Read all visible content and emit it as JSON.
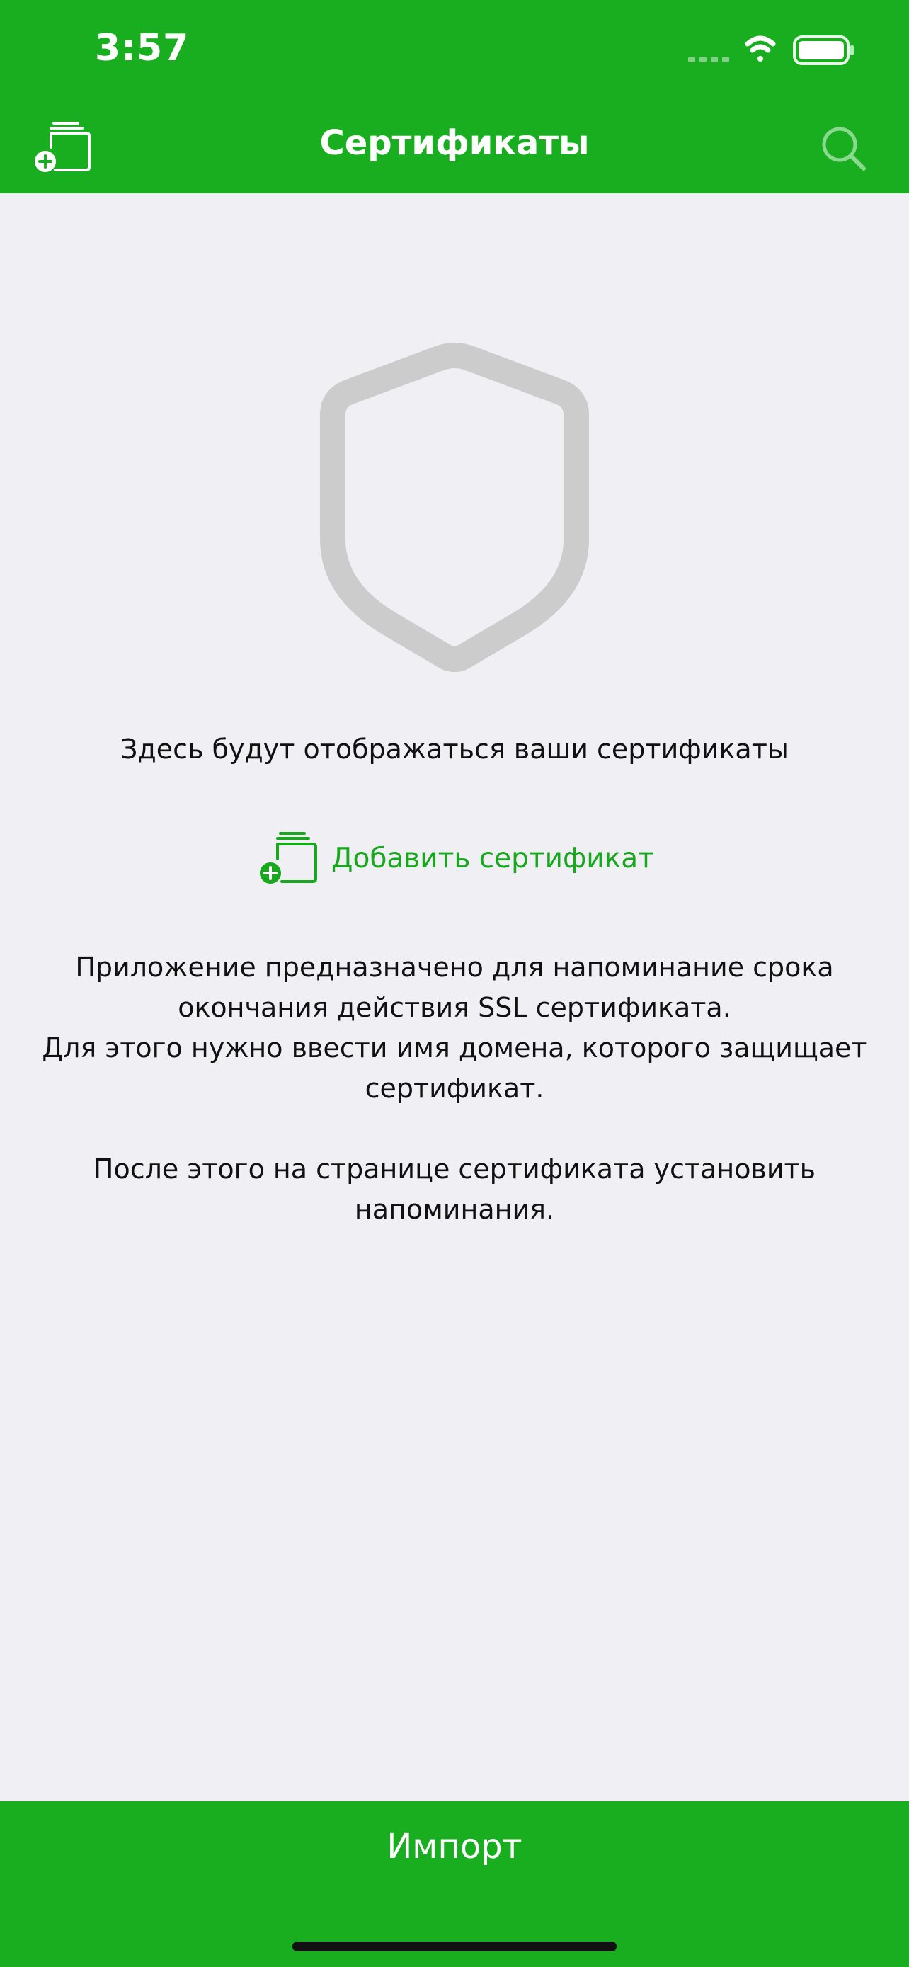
{
  "status_bar": {
    "time": "3:57",
    "icons": [
      "signal-icon",
      "wifi-icon",
      "battery-icon"
    ]
  },
  "nav": {
    "title": "Сертификаты",
    "left_icon": "add-certificate-icon",
    "right_icon": "search-icon"
  },
  "empty_state": {
    "icon": "shield-icon",
    "message": "Здесь будут отображаться ваши сертификаты",
    "add_button_label": "Добавить сертификат"
  },
  "description": {
    "paragraph1": "Приложение предназначено для напоминание срока окончания действия SSL сертификата.",
    "paragraph2": "Для этого нужно ввести имя домена, которого защищает сертификат.",
    "paragraph3": "После этого на странице сертификата установить напоминания."
  },
  "footer": {
    "import_label": "Импорт"
  },
  "colors": {
    "accent": "#18ae1f",
    "link": "#17a81d",
    "background": "#f0eff4",
    "shield": "#cccccc"
  }
}
